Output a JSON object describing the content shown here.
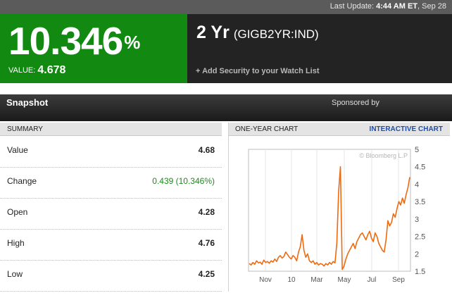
{
  "topbar": {
    "last_update_label": "Last Update:",
    "last_update_time": "4:44 AM ET",
    "last_update_date": ", Sep 28"
  },
  "quote": {
    "change_pct": "10.346",
    "pct_sign": "%",
    "value_label": "VALUE:",
    "value": "4.678",
    "name": "2 Yr",
    "ticker": "(GIGB2YR:IND)",
    "watch_label": "+ Add Security to your Watch List",
    "colors": {
      "up": "#128a12",
      "dark": "#232323"
    }
  },
  "snapshot": {
    "title": "Snapshot",
    "sponsored": "Sponsored by"
  },
  "summary": {
    "header": "SUMMARY",
    "rows": [
      {
        "label": "Value",
        "value": "4.68"
      },
      {
        "label": "Change",
        "value": "0.439 (10.346%)"
      },
      {
        "label": "Open",
        "value": "4.28"
      },
      {
        "label": "High",
        "value": "4.76"
      },
      {
        "label": "Low",
        "value": "4.25"
      }
    ]
  },
  "chart": {
    "header": "ONE-YEAR CHART",
    "interactive_label": "INTERACTIVE CHART",
    "watermark": "© Bloomberg L.P",
    "line_color": "#ee6a10"
  },
  "chart_data": {
    "type": "line",
    "xlabel": "",
    "ylabel": "",
    "ylim": [
      1.5,
      5
    ],
    "yticks": [
      "5",
      "4.5",
      "4",
      "3.5",
      "3",
      "2.5",
      "2",
      "1.5"
    ],
    "x_tick_labels": [
      "Nov",
      "10",
      "Mar",
      "May",
      "Jul",
      "Sep"
    ],
    "grid": "vertical",
    "series": [
      {
        "values": [
          1.72,
          1.68,
          1.75,
          1.7,
          1.8,
          1.74,
          1.76,
          1.7,
          1.82,
          1.75,
          1.78,
          1.73,
          1.8,
          1.76,
          1.85,
          1.78,
          1.9,
          1.95,
          1.88,
          1.92,
          2.05,
          1.98,
          1.9,
          1.85,
          1.95,
          1.9,
          1.8,
          2.05,
          2.2,
          2.55,
          2.1,
          1.9,
          2.0,
          1.8,
          1.75,
          1.8,
          1.7,
          1.75,
          1.68,
          1.72,
          1.7,
          1.65,
          1.72,
          1.68,
          1.75,
          1.7,
          1.78,
          1.74,
          2.3,
          3.8,
          4.5,
          1.55,
          1.65,
          1.85,
          2.0,
          2.1,
          2.2,
          2.3,
          2.15,
          2.35,
          2.45,
          2.55,
          2.6,
          2.5,
          2.4,
          2.55,
          2.65,
          2.45,
          2.35,
          2.6,
          2.5,
          2.3,
          2.2,
          2.1,
          2.05,
          2.4,
          2.95,
          2.8,
          2.9,
          3.15,
          3.05,
          3.3,
          3.5,
          3.4,
          3.6,
          3.45,
          3.7,
          3.9,
          4.2
        ]
      }
    ]
  }
}
